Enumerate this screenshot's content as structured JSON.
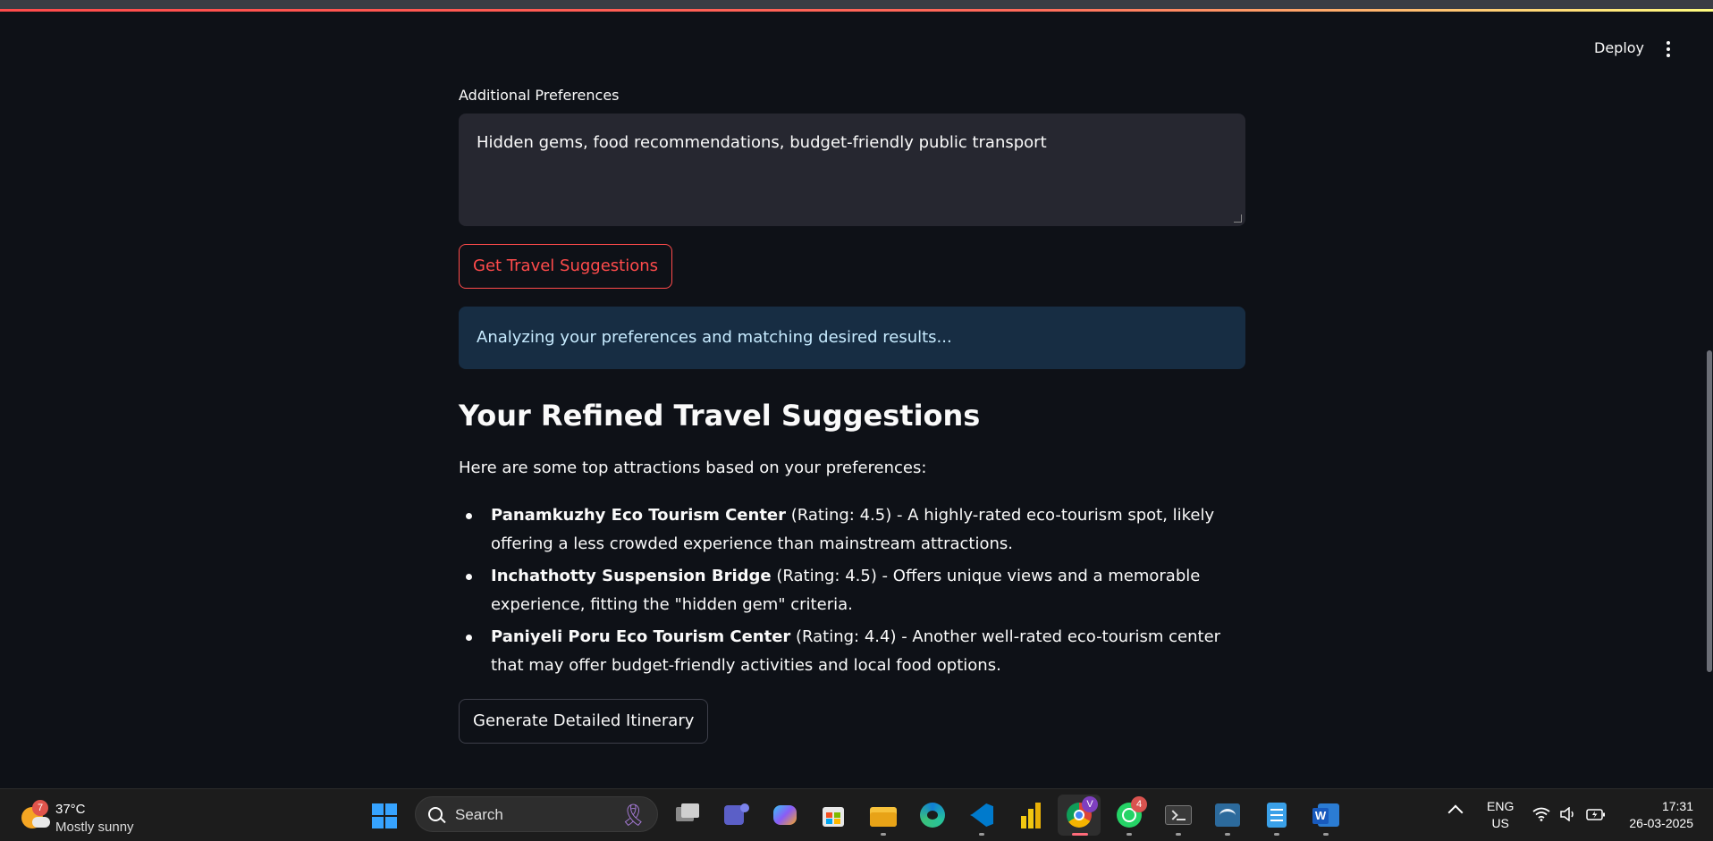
{
  "header": {
    "deploy_label": "Deploy"
  },
  "form": {
    "preferences_label": "Additional Preferences",
    "preferences_value": "Hidden gems, food recommendations, budget-friendly public transport",
    "submit_label": "Get Travel Suggestions"
  },
  "status": {
    "info_text": "Analyzing your preferences and matching desired results..."
  },
  "results": {
    "heading": "Your Refined Travel Suggestions",
    "intro": "Here are some top attractions based on your preferences:",
    "items": [
      {
        "name": "Panamkuzhy Eco Tourism Center",
        "desc": " (Rating: 4.5) - A highly-rated eco-tourism spot, likely offering a less crowded experience than mainstream attractions."
      },
      {
        "name": "Inchathotty Suspension Bridge",
        "desc": " (Rating: 4.5) - Offers unique views and a memorable experience, fitting the \"hidden gem\" criteria."
      },
      {
        "name": "Paniyeli Poru Eco Tourism Center",
        "desc": " (Rating: 4.4) - Another well-rated eco-tourism center that may offer budget-friendly activities and local food options."
      }
    ],
    "itinerary_label": "Generate Detailed Itinerary"
  },
  "taskbar": {
    "weather_badge": "7",
    "temperature": "37°C",
    "condition": "Mostly sunny",
    "search_placeholder": "Search",
    "chrome_badge": "V",
    "whatsapp_badge": "4",
    "lang_primary": "ENG",
    "lang_secondary": "US",
    "time": "17:31",
    "date": "26-03-2025",
    "apps": [
      "task-view",
      "teams",
      "copilot",
      "microsoft-store",
      "file-explorer",
      "edge",
      "vscode",
      "power-bi",
      "chrome",
      "whatsapp",
      "terminal",
      "mysql-workbench",
      "notepad",
      "word"
    ]
  },
  "colors": {
    "accent": "#ff4b4b",
    "background": "#0e1117",
    "info_bg": "#172d43",
    "info_text": "#c7ebff"
  }
}
